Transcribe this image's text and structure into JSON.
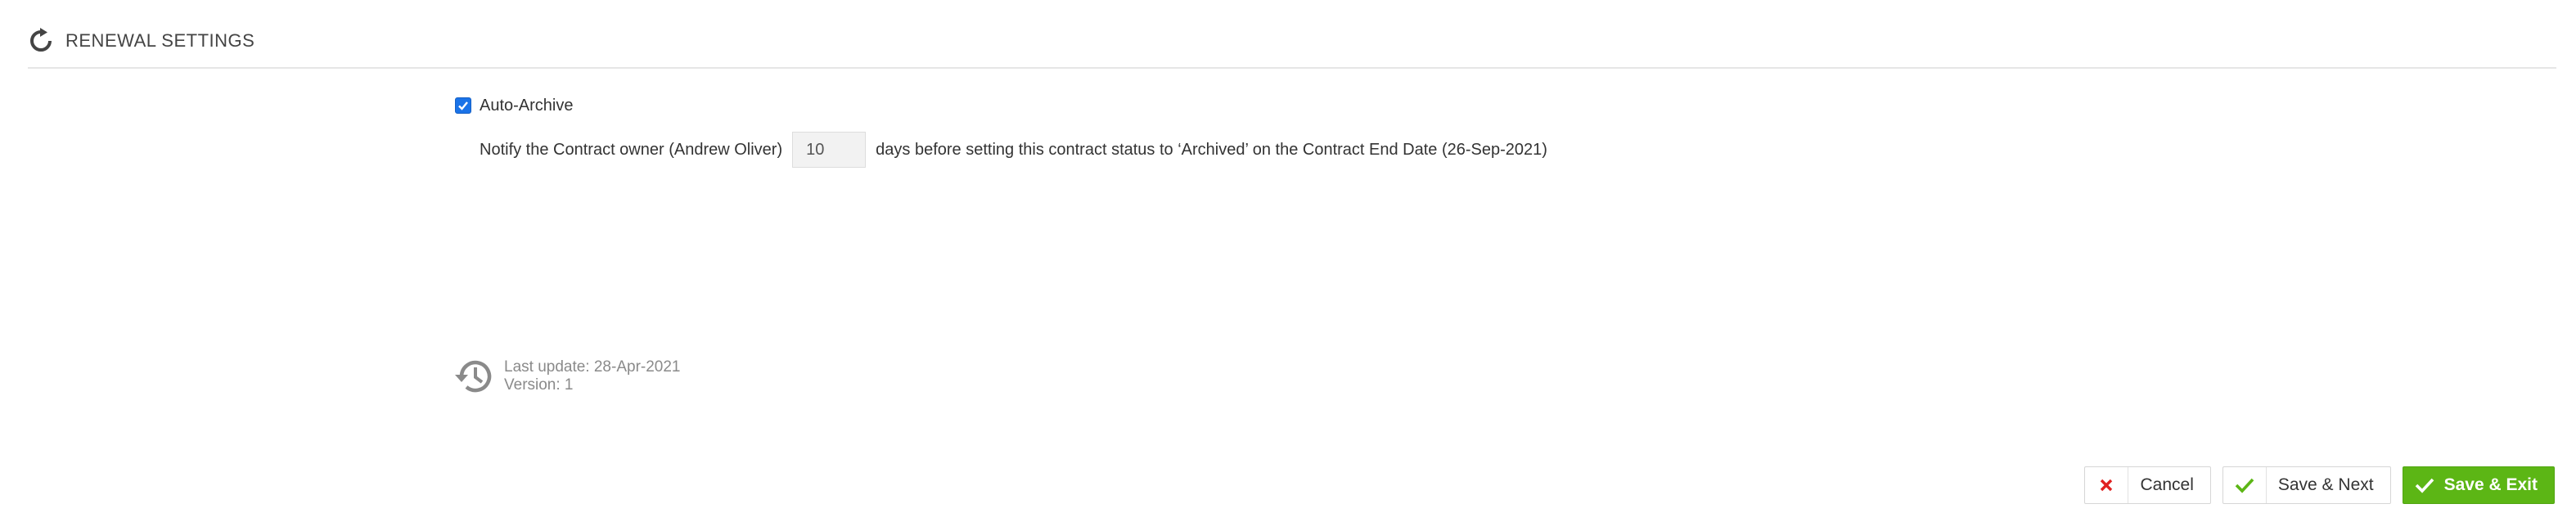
{
  "header": {
    "title": "RENEWAL SETTINGS",
    "icon": "refresh-icon"
  },
  "auto_archive": {
    "checked": true,
    "label": "Auto-Archive"
  },
  "notify": {
    "prefix": "Notify the Contract owner (Andrew Oliver)",
    "days_value": "10",
    "suffix": "days before setting this contract status to ‘Archived’ on the Contract End Date (26-Sep-2021)"
  },
  "last_update": {
    "icon": "history-icon",
    "line1": "Last update: 28-Apr-2021",
    "line2": "Version: 1"
  },
  "buttons": {
    "cancel": {
      "label": "Cancel",
      "icon": "close-icon",
      "icon_color": "#e02020"
    },
    "save_next": {
      "label": "Save & Next",
      "icon": "check-icon",
      "icon_color": "#5cb615"
    },
    "save_exit": {
      "label": "Save & Exit",
      "icon": "check-icon",
      "bg_color": "#5cb615"
    }
  },
  "colors": {
    "accent": "#1a73e8",
    "primary_button": "#5cb615",
    "muted_text": "#8a8a8a"
  }
}
